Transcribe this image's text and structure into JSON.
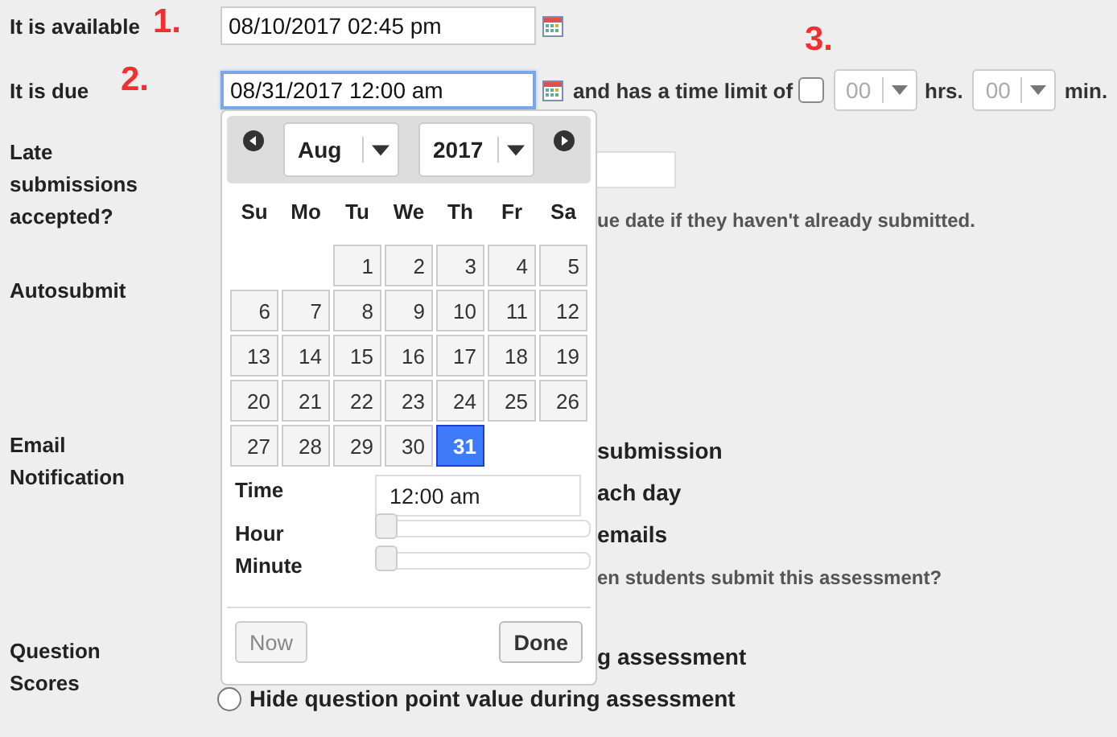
{
  "dates": [
    {
      "label": "It is available",
      "value": "08/10/2017 02:45 pm",
      "focused": false
    },
    {
      "label": "It is due",
      "value": "08/31/2017 12:00 am",
      "focused": true
    }
  ],
  "time_limit": {
    "label": "and has a time limit of",
    "checked": false,
    "hours": "00",
    "hours_unit": "hrs.",
    "minutes": "00",
    "minutes_unit": "min.",
    "disabled": true
  },
  "annotations": [
    "1.",
    "2.",
    "3."
  ],
  "sections": [
    {
      "label": "Late submissions accepted?",
      "lines": [
        {
          "kind": "field"
        },
        {
          "kind": "note",
          "text": "ue date if they haven't already submitted."
        }
      ]
    },
    {
      "label": "Autosubmit"
    },
    {
      "label": "Email Notification",
      "lines": [
        {
          "kind": "option",
          "text": "submission"
        },
        {
          "kind": "option",
          "text": "ach day"
        },
        {
          "kind": "option",
          "text": "emails"
        },
        {
          "kind": "note",
          "text": "en students submit this assessment?"
        }
      ]
    },
    {
      "label": "Question Scores",
      "lines": [
        {
          "kind": "option",
          "text": "g assessment"
        },
        {
          "kind": "radio",
          "text": "Hide question point value during assessment",
          "selected": false
        }
      ]
    }
  ],
  "datepicker": {
    "month": "Aug",
    "year": "2017",
    "weekdays": [
      "Su",
      "Mo",
      "Tu",
      "We",
      "Th",
      "Fr",
      "Sa"
    ],
    "weeks": [
      [
        {
          "kind": "blank"
        },
        {
          "kind": "blank"
        },
        {
          "kind": "day",
          "day": "1",
          "selected": false
        },
        {
          "kind": "day",
          "day": "2",
          "selected": false
        },
        {
          "kind": "day",
          "day": "3",
          "selected": false
        },
        {
          "kind": "day",
          "day": "4",
          "selected": false
        },
        {
          "kind": "day",
          "day": "5",
          "selected": false
        }
      ],
      [
        {
          "kind": "day",
          "day": "6",
          "selected": false
        },
        {
          "kind": "day",
          "day": "7",
          "selected": false
        },
        {
          "kind": "day",
          "day": "8",
          "selected": false
        },
        {
          "kind": "day",
          "day": "9",
          "selected": false
        },
        {
          "kind": "day",
          "day": "10",
          "selected": false
        },
        {
          "kind": "day",
          "day": "11",
          "selected": false
        },
        {
          "kind": "day",
          "day": "12",
          "selected": false
        }
      ],
      [
        {
          "kind": "day",
          "day": "13",
          "selected": false
        },
        {
          "kind": "day",
          "day": "14",
          "selected": false
        },
        {
          "kind": "day",
          "day": "15",
          "selected": false
        },
        {
          "kind": "day",
          "day": "16",
          "selected": false
        },
        {
          "kind": "day",
          "day": "17",
          "selected": false
        },
        {
          "kind": "day",
          "day": "18",
          "selected": false
        },
        {
          "kind": "day",
          "day": "19",
          "selected": false
        }
      ],
      [
        {
          "kind": "day",
          "day": "20",
          "selected": false
        },
        {
          "kind": "day",
          "day": "21",
          "selected": false
        },
        {
          "kind": "day",
          "day": "22",
          "selected": false
        },
        {
          "kind": "day",
          "day": "23",
          "selected": false
        },
        {
          "kind": "day",
          "day": "24",
          "selected": false
        },
        {
          "kind": "day",
          "day": "25",
          "selected": false
        },
        {
          "kind": "day",
          "day": "26",
          "selected": false
        }
      ],
      [
        {
          "kind": "day",
          "day": "27",
          "selected": false
        },
        {
          "kind": "day",
          "day": "28",
          "selected": false
        },
        {
          "kind": "day",
          "day": "29",
          "selected": false
        },
        {
          "kind": "day",
          "day": "30",
          "selected": false
        },
        {
          "kind": "day",
          "day": "31",
          "selected": true
        }
      ]
    ],
    "time_label": "Time",
    "time_value": "12:00 am",
    "sliders": [
      {
        "label": "Hour",
        "level": 0
      },
      {
        "label": "Minute",
        "level": 0
      }
    ],
    "now_button": {
      "label": "Now",
      "disabled": true
    },
    "done_button": {
      "label": "Done",
      "disabled": false
    }
  }
}
